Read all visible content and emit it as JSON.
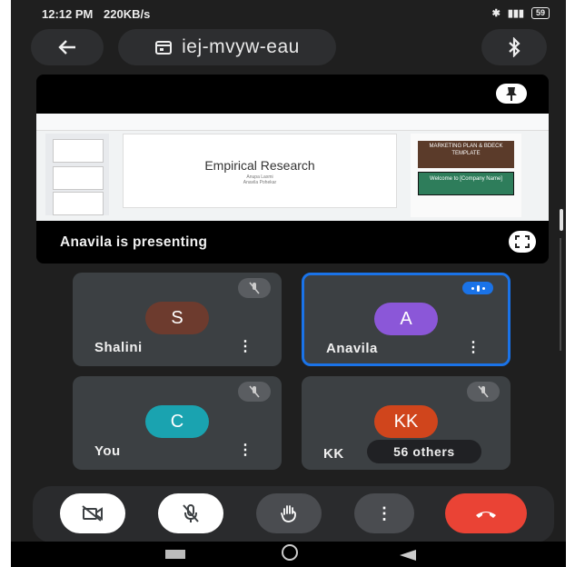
{
  "status": {
    "time": "12:12 PM",
    "network": "220KB/s",
    "signal": "4G",
    "battery": "59"
  },
  "meeting": {
    "code": "iej-mvyw-eau"
  },
  "presentation": {
    "doc_title": "Empirical Research",
    "doc_subtitle_1": "Anupa Laxmi",
    "doc_subtitle_2": "Anavila Pohekar",
    "side_card_1": "MARKETING PLAN & BDECK TEMPLATE",
    "side_card_2": "Welcome to [Company Name]",
    "presenter_text": "Anavila is presenting"
  },
  "participants": [
    {
      "name": "Shalini",
      "initial": "S",
      "color": "#6d3b2e",
      "muted": true,
      "speaking": false
    },
    {
      "name": "Anavila",
      "initial": "A",
      "color": "#8b57d8",
      "muted": false,
      "speaking": true
    },
    {
      "name": "You",
      "initial": "C",
      "color": "#1aa3b0",
      "muted": true,
      "speaking": false
    },
    {
      "name": "KK",
      "initial": "KK",
      "color": "#d0451c",
      "muted": true,
      "speaking": false
    }
  ],
  "others_label": "56 others",
  "controls": [
    "camera-off",
    "mic-off",
    "raise-hand",
    "more",
    "end-call"
  ],
  "colors": {
    "end_call": "#ea4335",
    "speaking_border": "#1a73e8"
  }
}
